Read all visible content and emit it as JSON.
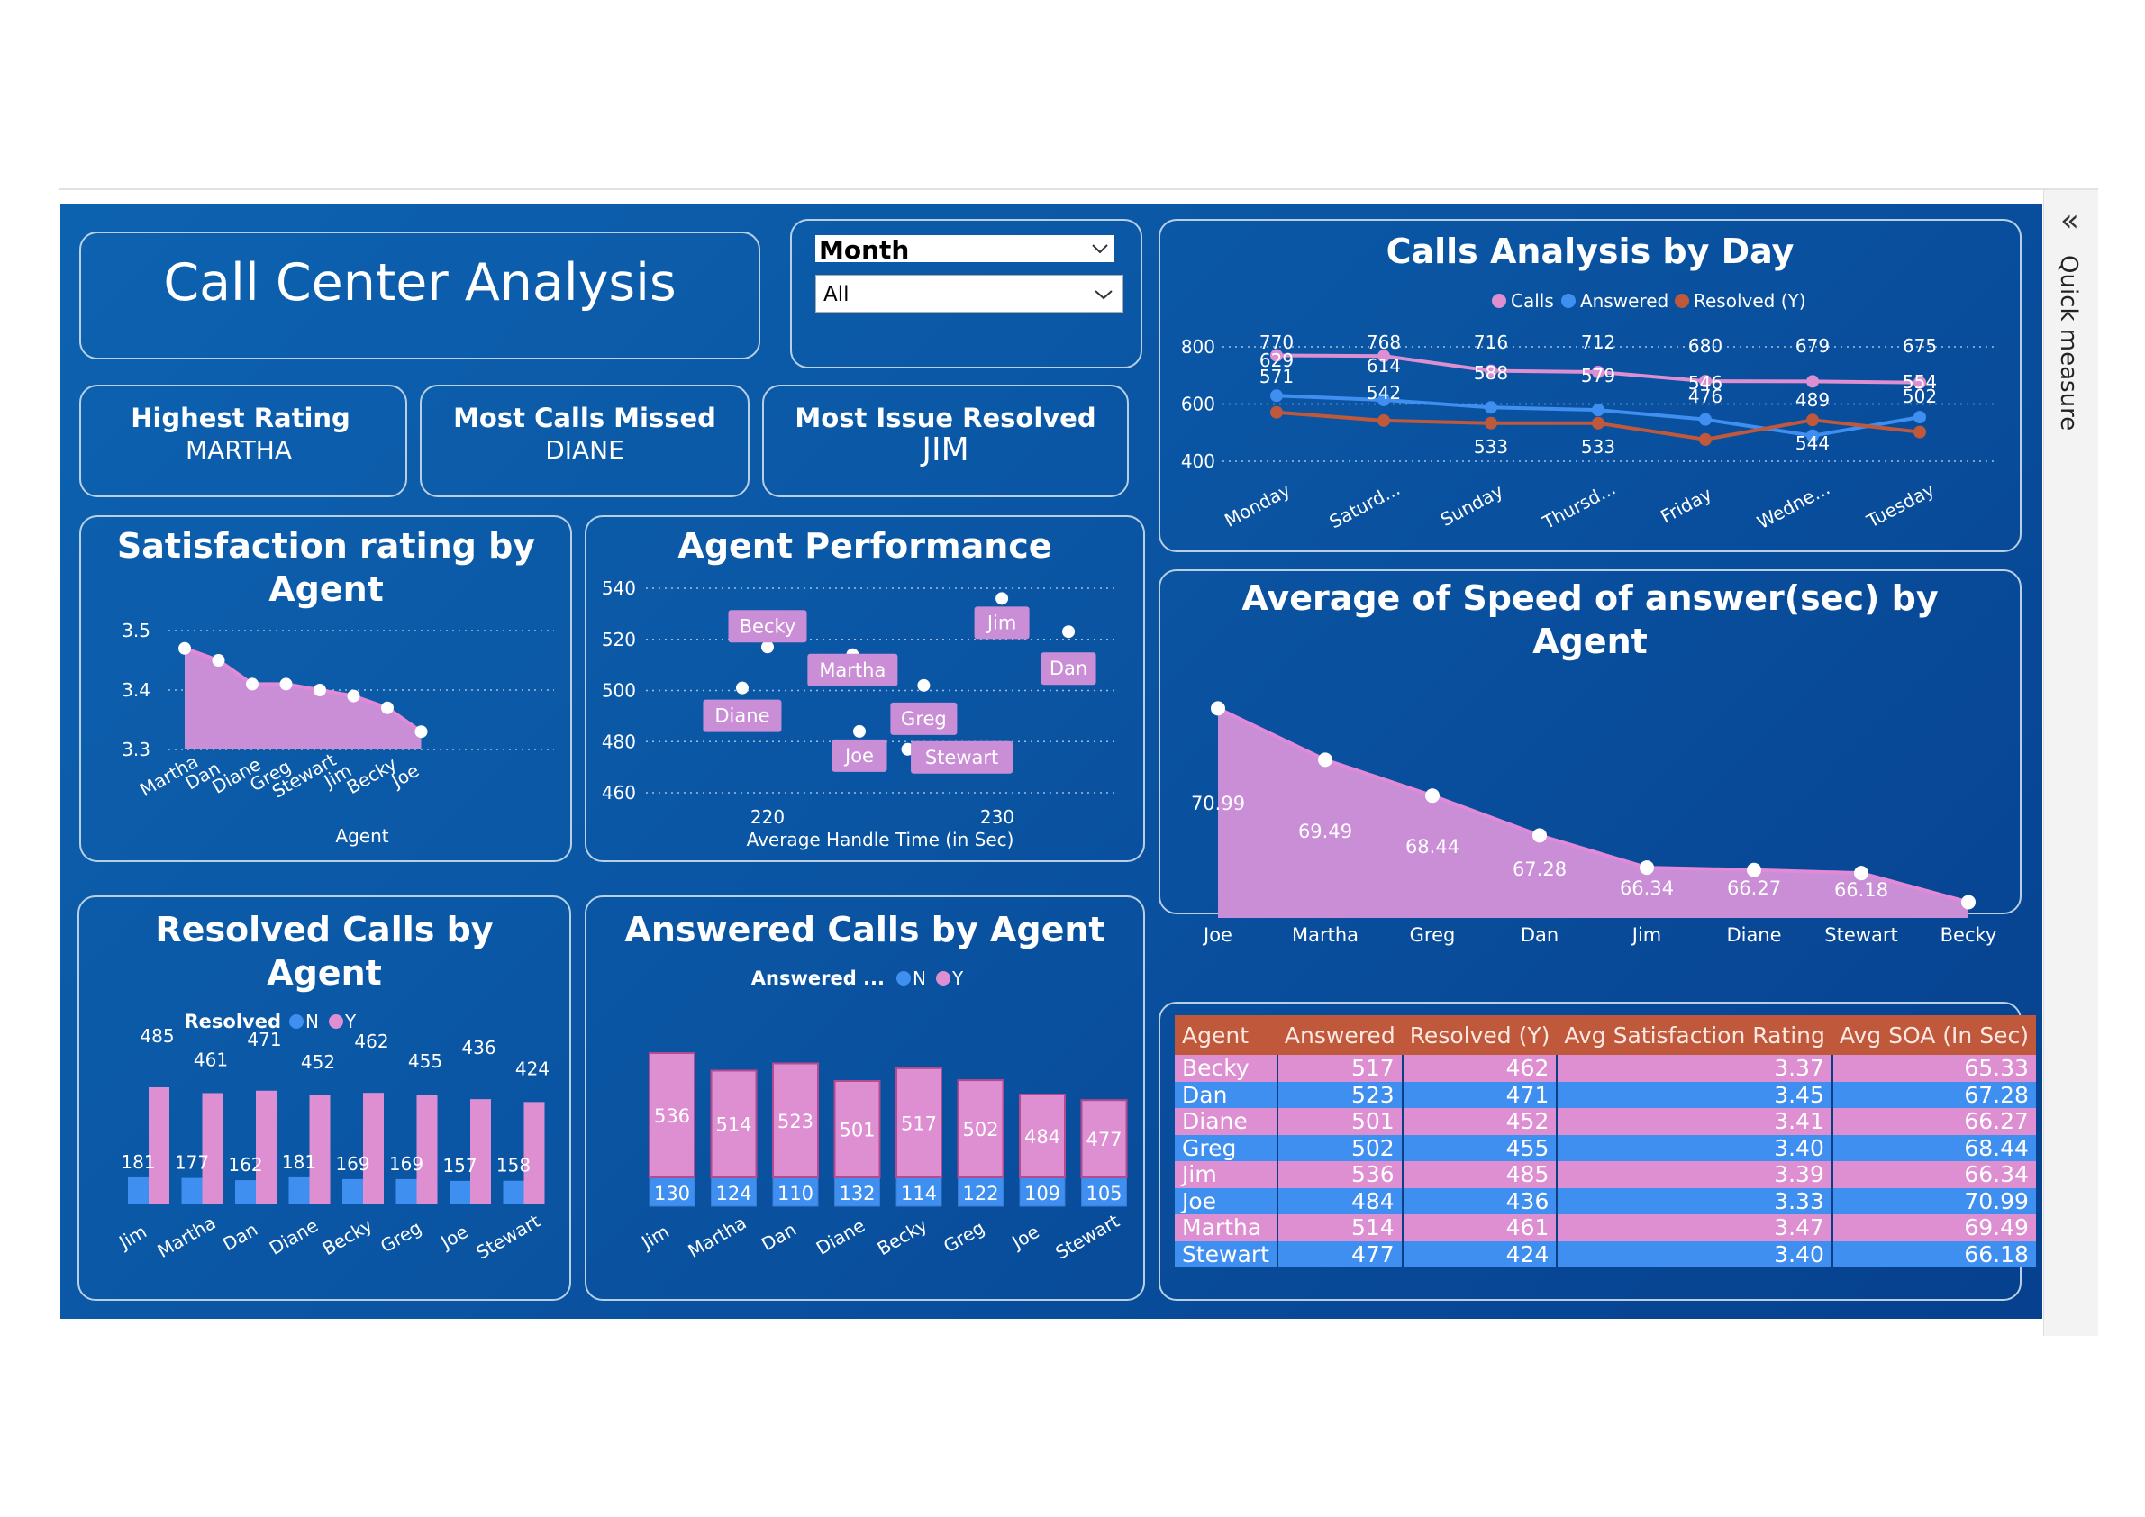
{
  "title": "Call Center Analysis",
  "quick_measure": "Quick measure",
  "filter": {
    "label": "Month",
    "value": "All"
  },
  "kpis": [
    {
      "label": "Highest Rating",
      "value": "MARTHA"
    },
    {
      "label": "Most Calls Missed",
      "value": "DIANE"
    },
    {
      "label": "Most Issue Resolved",
      "value": "JIM"
    }
  ],
  "colors": {
    "pink": "#dd8fd2",
    "blue": "#3f8ff0",
    "orange": "#c0583b",
    "background": "#0a55a3"
  },
  "icons": {
    "collapse": "double-chevron-left-icon",
    "dropdown": "chevron-down-icon"
  },
  "charts": {
    "day": {
      "title": "Calls Analysis by Day",
      "legend": [
        "Calls",
        "Answered",
        "Resolved (Y)"
      ],
      "categories": [
        "Monday",
        "Saturd...",
        "Sunday",
        "Thursd...",
        "Friday",
        "Wedne...",
        "Tuesday"
      ],
      "yticks": [
        "800",
        "600",
        "400"
      ],
      "calls_labels": [
        "770",
        "768",
        "716",
        "712",
        "680",
        "679",
        "675"
      ],
      "answered_labels": [
        "629",
        "614",
        "588",
        "579",
        "546",
        "489",
        "554"
      ],
      "resolved_labels": [
        "571",
        "542",
        "533",
        "533",
        "476",
        "544",
        "502"
      ]
    },
    "satisfaction": {
      "title": "Satisfaction rating by Agent",
      "xlabel": "Agent",
      "yticks": [
        "3.5",
        "3.4",
        "3.3"
      ],
      "categories": [
        "Martha",
        "Dan",
        "Diane",
        "Greg",
        "Stewart",
        "Jim",
        "Becky",
        "Joe"
      ]
    },
    "performance": {
      "title": "Agent Performance",
      "xlabel": "Average Handle Time (in Sec)",
      "yticks": [
        "540",
        "520",
        "500",
        "480",
        "460"
      ],
      "xticks": [
        "220",
        "230"
      ],
      "agents": [
        "Jim",
        "Dan",
        "Becky",
        "Martha",
        "Greg",
        "Diane",
        "Joe",
        "Stewart"
      ]
    },
    "speed": {
      "title": "Average of Speed of answer(sec) by Agent",
      "categories": [
        "Joe",
        "Martha",
        "Greg",
        "Dan",
        "Jim",
        "Diane",
        "Stewart",
        "Becky"
      ],
      "labels": [
        "70.99",
        "69.49",
        "68.44",
        "67.28",
        "66.34",
        "66.27",
        "66.18"
      ]
    },
    "resolved": {
      "title": "Resolved Calls by Agent",
      "legend_title": "Resolved",
      "legend": [
        "N",
        "Y"
      ],
      "categories": [
        "Jim",
        "Martha",
        "Dan",
        "Diane",
        "Becky",
        "Greg",
        "Joe",
        "Stewart"
      ],
      "n_labels": [
        "181",
        "177",
        "162",
        "181",
        "169",
        "169",
        "157",
        "158"
      ],
      "y_labels": [
        "485",
        "461",
        "471",
        "452",
        "462",
        "455",
        "436",
        "424"
      ]
    },
    "answered": {
      "title": "Answered Calls by Agent",
      "legend_title": "Answered ...",
      "legend": [
        "N",
        "Y"
      ],
      "categories": [
        "Jim",
        "Martha",
        "Dan",
        "Diane",
        "Becky",
        "Greg",
        "Joe",
        "Stewart"
      ],
      "y_labels": [
        "536",
        "514",
        "523",
        "501",
        "517",
        "502",
        "484",
        "477"
      ],
      "n_labels": [
        "130",
        "124",
        "110",
        "132",
        "114",
        "122",
        "109",
        "105"
      ]
    }
  },
  "table": {
    "headers": [
      "Agent",
      "Answered",
      "Resolved (Y)",
      "Avg Satisfaction Rating",
      "Avg SOA (In Sec)"
    ],
    "rows": [
      [
        "Becky",
        "517",
        "462",
        "3.37",
        "65.33"
      ],
      [
        "Dan",
        "523",
        "471",
        "3.45",
        "67.28"
      ],
      [
        "Diane",
        "501",
        "452",
        "3.41",
        "66.27"
      ],
      [
        "Greg",
        "502",
        "455",
        "3.40",
        "68.44"
      ],
      [
        "Jim",
        "536",
        "485",
        "3.39",
        "66.34"
      ],
      [
        "Joe",
        "484",
        "436",
        "3.33",
        "70.99"
      ],
      [
        "Martha",
        "514",
        "461",
        "3.47",
        "69.49"
      ],
      [
        "Stewart",
        "477",
        "424",
        "3.40",
        "66.18"
      ]
    ]
  },
  "chart_data": [
    {
      "type": "line",
      "title": "Calls Analysis by Day",
      "categories": [
        "Monday",
        "Saturd...",
        "Sunday",
        "Thursd...",
        "Friday",
        "Wedne...",
        "Tuesday"
      ],
      "ylim": [
        400,
        800
      ],
      "grid": true,
      "legend_position": "top",
      "series": [
        {
          "name": "Calls",
          "values": [
            770,
            768,
            716,
            712,
            680,
            679,
            675
          ]
        },
        {
          "name": "Answered",
          "values": [
            629,
            614,
            588,
            579,
            546,
            489,
            554
          ]
        },
        {
          "name": "Resolved (Y)",
          "values": [
            571,
            542,
            533,
            533,
            476,
            544,
            502
          ]
        }
      ]
    },
    {
      "type": "area",
      "title": "Satisfaction rating by Agent",
      "xlabel": "Agent",
      "categories": [
        "Martha",
        "Dan",
        "Diane",
        "Greg",
        "Stewart",
        "Jim",
        "Becky",
        "Joe"
      ],
      "values": [
        3.47,
        3.45,
        3.41,
        3.41,
        3.4,
        3.39,
        3.37,
        3.33
      ],
      "ylim": [
        3.3,
        3.5
      ],
      "grid": true
    },
    {
      "type": "scatter",
      "title": "Agent Performance",
      "xlabel": "Average Handle Time (in Sec)",
      "xlim": [
        215,
        235
      ],
      "ylim": [
        460,
        540
      ],
      "points": [
        {
          "label": "Jim",
          "x": 230.2,
          "y": 536
        },
        {
          "label": "Dan",
          "x": 233.1,
          "y": 523
        },
        {
          "label": "Becky",
          "x": 220.0,
          "y": 517
        },
        {
          "label": "Martha",
          "x": 223.7,
          "y": 514
        },
        {
          "label": "Greg",
          "x": 226.8,
          "y": 502
        },
        {
          "label": "Diane",
          "x": 218.9,
          "y": 501
        },
        {
          "label": "Joe",
          "x": 224.0,
          "y": 484
        },
        {
          "label": "Stewart",
          "x": 226.1,
          "y": 477
        }
      ]
    },
    {
      "type": "area",
      "title": "Average of Speed of answer(sec) by Agent",
      "categories": [
        "Joe",
        "Martha",
        "Greg",
        "Dan",
        "Jim",
        "Diane",
        "Stewart",
        "Becky"
      ],
      "values": [
        70.99,
        69.49,
        68.44,
        67.28,
        66.34,
        66.27,
        66.18,
        65.33
      ],
      "ylim": [
        65,
        71.5
      ]
    },
    {
      "type": "bar",
      "title": "Resolved Calls by Agent",
      "categories": [
        "Jim",
        "Martha",
        "Dan",
        "Diane",
        "Becky",
        "Greg",
        "Joe",
        "Stewart"
      ],
      "legend_position": "top",
      "series": [
        {
          "name": "N",
          "values": [
            181,
            177,
            162,
            181,
            169,
            169,
            157,
            158
          ]
        },
        {
          "name": "Y",
          "values": [
            485,
            461,
            471,
            452,
            462,
            455,
            436,
            424
          ]
        }
      ]
    },
    {
      "type": "bar",
      "title": "Answered Calls by Agent",
      "stacked": true,
      "categories": [
        "Jim",
        "Martha",
        "Dan",
        "Diane",
        "Becky",
        "Greg",
        "Joe",
        "Stewart"
      ],
      "legend_position": "top",
      "series": [
        {
          "name": "N",
          "values": [
            130,
            124,
            110,
            132,
            114,
            122,
            109,
            105
          ]
        },
        {
          "name": "Y",
          "values": [
            536,
            514,
            523,
            501,
            517,
            502,
            484,
            477
          ]
        }
      ]
    }
  ]
}
